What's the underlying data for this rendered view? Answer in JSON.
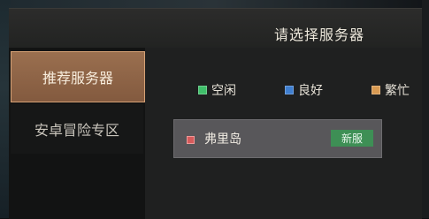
{
  "header": {
    "title": "请选择服务器"
  },
  "sidebar": {
    "tabs": [
      {
        "label": "推荐服务器",
        "active": true
      },
      {
        "label": "安卓冒险专区",
        "active": false
      }
    ]
  },
  "legend": [
    {
      "label": "空闲",
      "color": "#3fbf6a"
    },
    {
      "label": "良好",
      "color": "#3f7fd0"
    },
    {
      "label": "繁忙",
      "color": "#d89a52"
    }
  ],
  "servers": [
    {
      "name": "弗里岛",
      "status_color": "#d65b5b",
      "badge": "新服",
      "badge_color": "#3e8f55"
    }
  ]
}
